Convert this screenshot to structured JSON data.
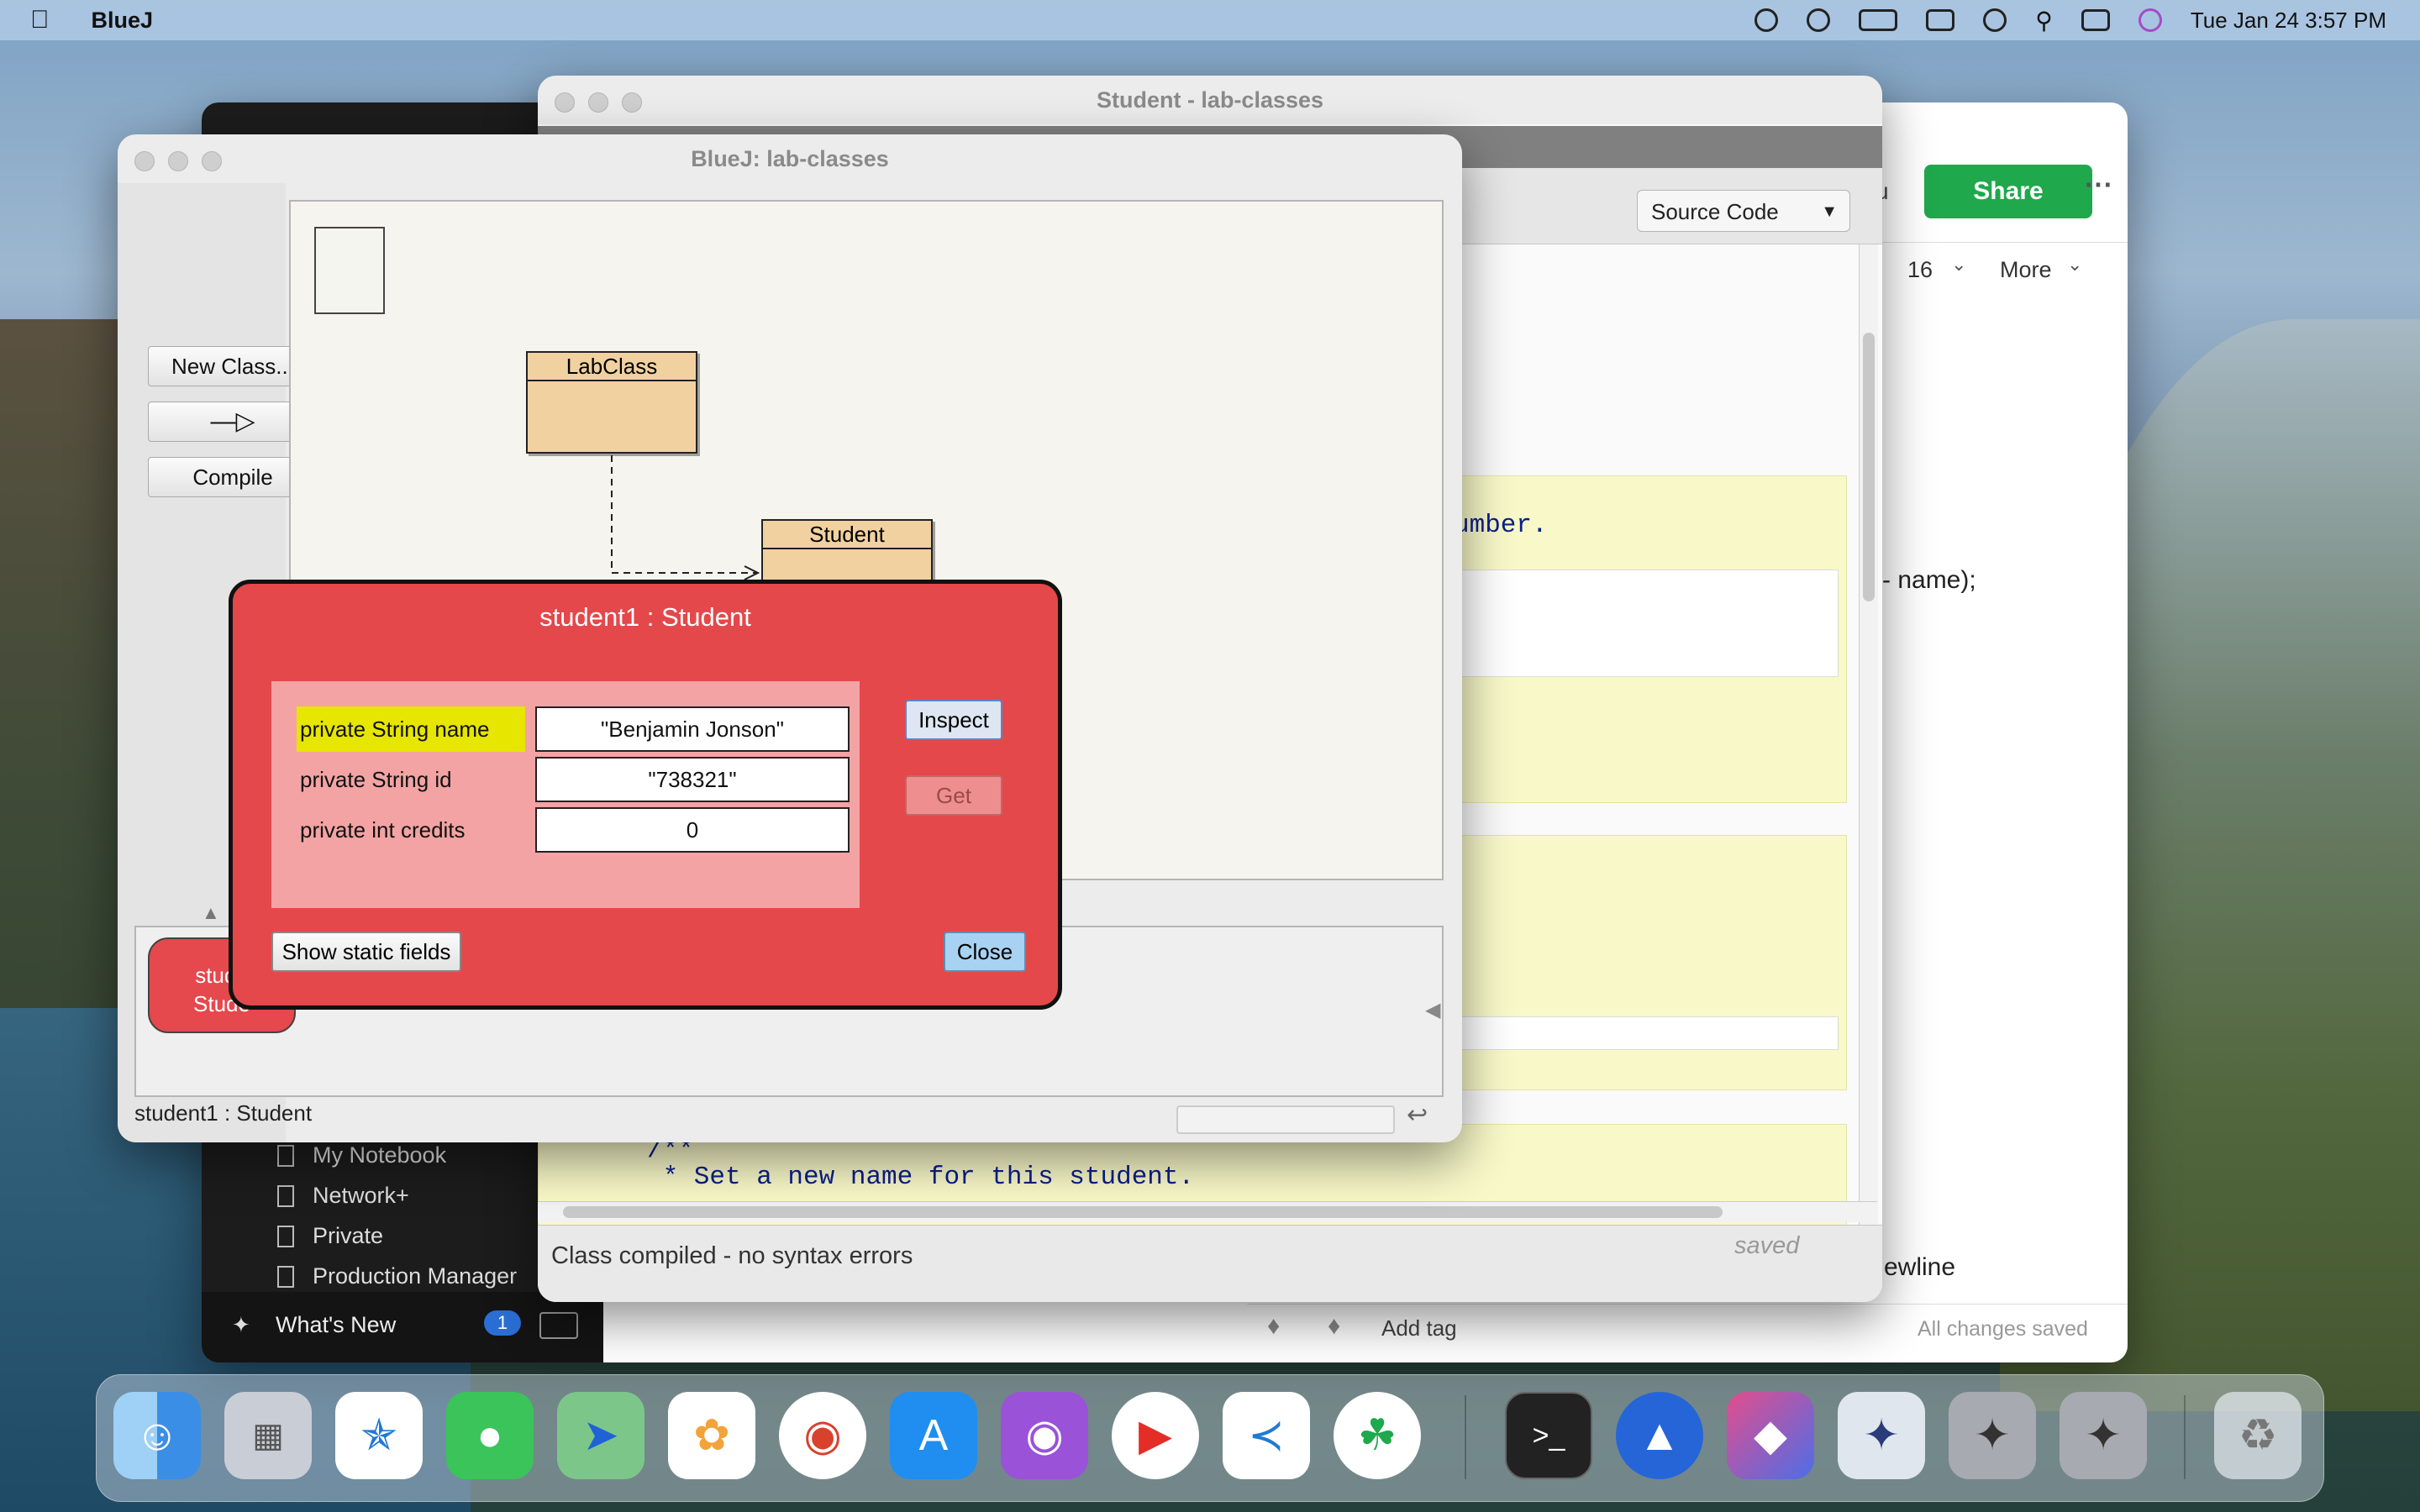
{
  "menubar": {
    "apple": "",
    "app_name": "BlueJ",
    "clock": "Tue Jan 24  3:57 PM"
  },
  "evernote": {
    "share_label": "Share",
    "more_label": "More",
    "font_size": "16",
    "partial_left_text": "u",
    "partial_code_text": "- name);",
    "partial_bottom_text": "ewline",
    "sidebar_items": [
      "My Notebook",
      "Network+",
      "Private",
      "Production Manager"
    ],
    "whats_new": "What's New",
    "whats_new_count": "1",
    "add_tag": "Add tag",
    "status": "All changes saved"
  },
  "source_window": {
    "title": "Student - lab-classes",
    "view_select": "Source Code",
    "code_fragment_1": "umber.",
    "code_fragment_2": "/**",
    "code_fragment_3": " * Set a new name for this student.",
    "status": "Class compiled - no syntax errors",
    "saved": "saved"
  },
  "bluej": {
    "title": "BlueJ:  lab-classes",
    "buttons": {
      "new_class": "New Class...",
      "compile": "Compile"
    },
    "classes": [
      {
        "name": "LabClass"
      },
      {
        "name": "Student"
      }
    ],
    "object_bench": {
      "line1": "stude",
      "line2": "Stude"
    },
    "status": "student1 : Student"
  },
  "inspector": {
    "title": "student1 : Student",
    "fields": [
      {
        "label": "private String name",
        "value": "\"Benjamin Jonson\""
      },
      {
        "label": "private String id",
        "value": "\"738321\""
      },
      {
        "label": "private int credits",
        "value": "0"
      }
    ],
    "inspect_label": "Inspect",
    "get_label": "Get",
    "static_fields_label": "Show static fields",
    "close_label": "Close"
  },
  "dock_apps": [
    "Finder",
    "Launchpad",
    "Safari",
    "Messages",
    "Maps",
    "Photos",
    "Chrome",
    "App Store",
    "Podcasts",
    "YouTube",
    "VS Code",
    "Evernote",
    "Terminal",
    "NordVPN",
    "Shortcuts",
    "BlueJ",
    "BlueJ",
    "BlueJ",
    "Trash"
  ],
  "colors": {
    "inspector_bg": "#e4484b",
    "class_fill": "#f1d1a0",
    "share_green": "#20a84d"
  }
}
